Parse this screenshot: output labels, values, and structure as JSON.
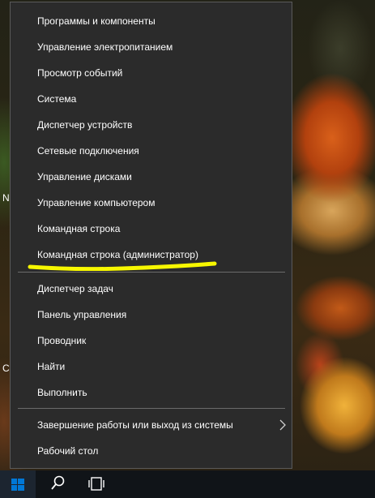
{
  "menu": {
    "items": [
      {
        "label": "Программы и компоненты"
      },
      {
        "label": "Управление электропитанием"
      },
      {
        "label": "Просмотр событий"
      },
      {
        "label": "Система"
      },
      {
        "label": "Диспетчер устройств"
      },
      {
        "label": "Сетевые подключения"
      },
      {
        "label": "Управление дисками"
      },
      {
        "label": "Управление компьютером"
      },
      {
        "label": "Командная строка"
      },
      {
        "label": "Командная строка (администратор)"
      },
      {
        "label": "Диспетчер задач"
      },
      {
        "label": "Панель управления"
      },
      {
        "label": "Проводник"
      },
      {
        "label": "Найти"
      },
      {
        "label": "Выполнить"
      },
      {
        "label": "Завершение работы или выход из системы"
      },
      {
        "label": "Рабочий стол"
      }
    ]
  },
  "desktop": {
    "fragment_m": "N",
    "fragment_c": "C"
  },
  "colors": {
    "menu_bg": "#2b2b2b",
    "highlight": "#f7f700",
    "start_blue": "#0078d7"
  },
  "icons": {
    "start": "windows-logo-icon",
    "search": "search-icon",
    "taskview": "task-view-icon",
    "submenu": "chevron-right-icon"
  }
}
